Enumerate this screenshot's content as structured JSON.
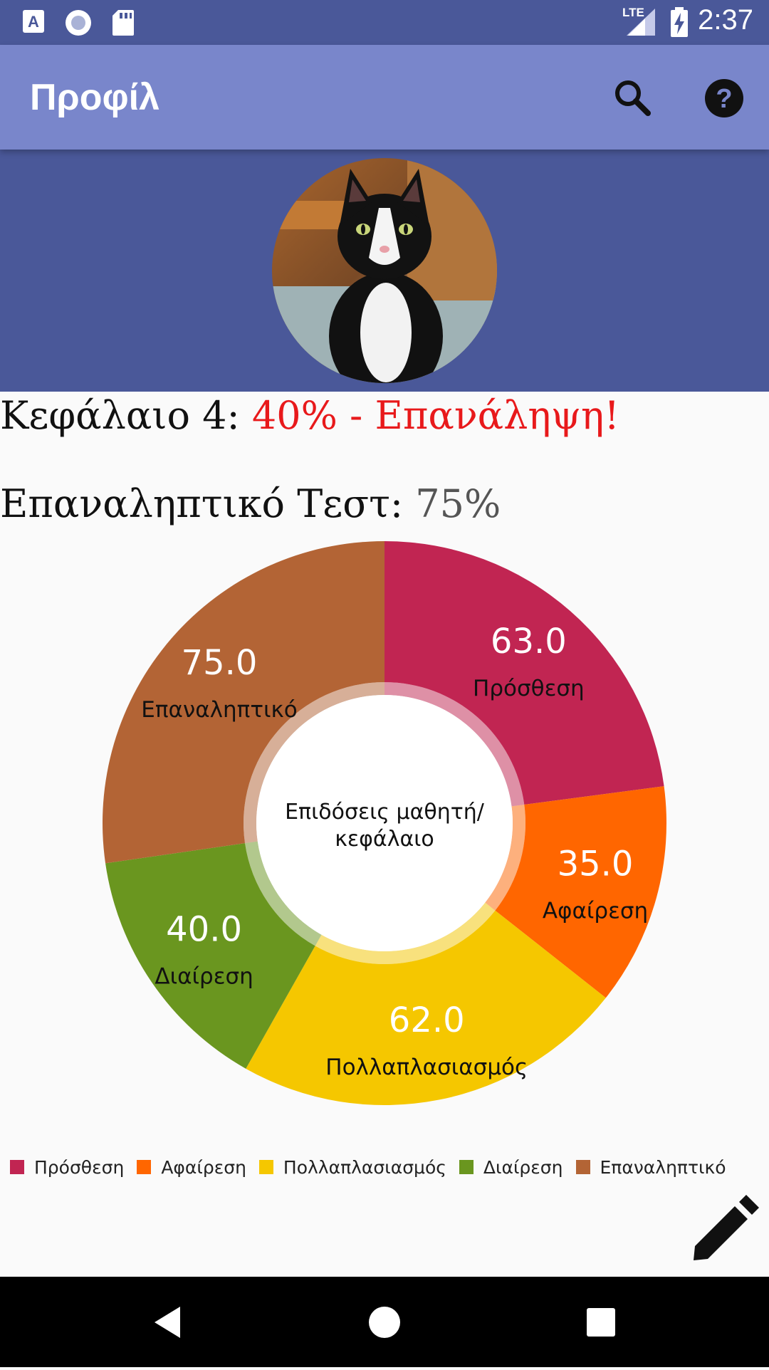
{
  "status_bar": {
    "time": "2:37",
    "network": "LTE",
    "icons": [
      "accessibility-a-icon",
      "record-icon",
      "sd-card-icon",
      "signal-icon",
      "battery-charging-icon"
    ]
  },
  "app_bar": {
    "title": "Προφίλ",
    "actions": [
      "search-icon",
      "help-icon"
    ]
  },
  "profile": {
    "avatar": "cat-avatar-image"
  },
  "chapter": {
    "label": "Κεφάλαιο 4: ",
    "status": "40% - Επανάληψη!",
    "status_color": "#e8191b"
  },
  "test": {
    "label": "Επαναληπτικό Τεστ: ",
    "score": "75%"
  },
  "chart_data": {
    "type": "pie",
    "center_text": [
      "Επιδόσεις μαθητή/",
      "κεφάλαιο"
    ],
    "categories": [
      "Πρόσθεση",
      "Αφαίρεση",
      "Πολλαπλασιασμός",
      "Διαίρεση",
      "Επαναληπτικό"
    ],
    "values": [
      63.0,
      35.0,
      62.0,
      40.0,
      75.0
    ],
    "value_labels": [
      "63.0",
      "35.0",
      "62.0",
      "40.0",
      "75.0"
    ],
    "colors": [
      "#c12552",
      "#ff6600",
      "#f5c700",
      "#6a961f",
      "#b36435"
    ],
    "legend": "bottom-left",
    "donut": true
  },
  "fab": {
    "icon": "pencil-edit-icon"
  },
  "nav_bar": {
    "buttons": [
      "back-icon",
      "home-icon",
      "recents-icon"
    ]
  }
}
